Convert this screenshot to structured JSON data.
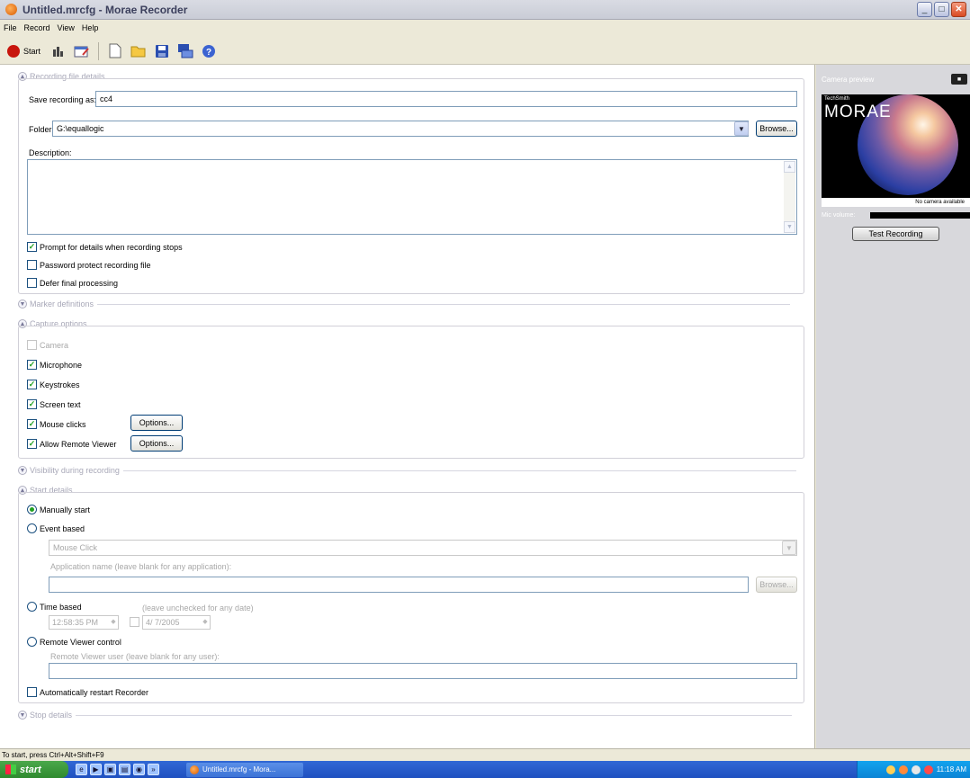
{
  "window": {
    "title": "Untitled.mrcfg - Morae Recorder",
    "buttons": [
      "_",
      "□",
      "✕"
    ]
  },
  "menu": [
    "File",
    "Record",
    "View",
    "Help"
  ],
  "toolbar": {
    "start_label": "Start",
    "icons": [
      "stats-icon",
      "edit-icon",
      "new-file-icon",
      "open-folder-icon",
      "save-icon",
      "network-icon",
      "help-icon"
    ]
  },
  "sections": {
    "recording_file_details": "Recording file details",
    "marker_definitions": "Marker definitions",
    "capture_options": "Capture options",
    "visibility": "Visibility during recording",
    "start_details": "Start details",
    "stop_details": "Stop details"
  },
  "recording": {
    "save_label": "Save recording as:",
    "save_value": "cc4",
    "folder_label": "Folder:",
    "folder_value": "G:\\equallogic",
    "browse": "Browse...",
    "description_label": "Description:",
    "description_value": "",
    "options": [
      {
        "label": "Prompt for details when recording stops",
        "checked": true
      },
      {
        "label": "Password protect recording file",
        "checked": false
      },
      {
        "label": "Defer final processing",
        "checked": false
      }
    ]
  },
  "capture": {
    "camera": {
      "label": "Camera",
      "checked": false
    },
    "microphone": {
      "label": "Microphone",
      "checked": true
    },
    "keystrokes": {
      "label": "Keystrokes",
      "checked": true
    },
    "screen_text": {
      "label": "Screen text",
      "checked": true
    },
    "mouse_clicks": {
      "label": "Mouse clicks",
      "checked": true
    },
    "remote_viewer": {
      "label": "Allow Remote Viewer",
      "checked": true
    },
    "options_btn": "Options..."
  },
  "start": {
    "manually": "Manually start",
    "event_based": "Event based",
    "event_dropdown": "Mouse Click",
    "app_name_label": "Application name (leave blank for any application):",
    "app_name_value": "",
    "browse": "Browse...",
    "time_based": "Time based",
    "time_hint": "(leave unchecked for any date)",
    "time_value": "12:58:35 PM",
    "date_value": "4/ 7/2005",
    "remote_control": "Remote Viewer control",
    "remote_user_label": "Remote Viewer user (leave blank for any user):",
    "remote_user_value": "",
    "auto_restart": "Automatically restart Recorder",
    "selected": "manually"
  },
  "right_panel": {
    "camera_label": "Camera preview",
    "brand_small": "TechSmith",
    "brand_big": "MORAE",
    "no_camera": "No camera available",
    "mic_label": "Mic volume:",
    "test_button": "Test Recording"
  },
  "status_bar": "To start, press Ctrl+Alt+Shift+F9",
  "taskbar": {
    "start": "start",
    "task": "Untitled.mrcfg - Mora...",
    "clock": "11:18 AM"
  }
}
